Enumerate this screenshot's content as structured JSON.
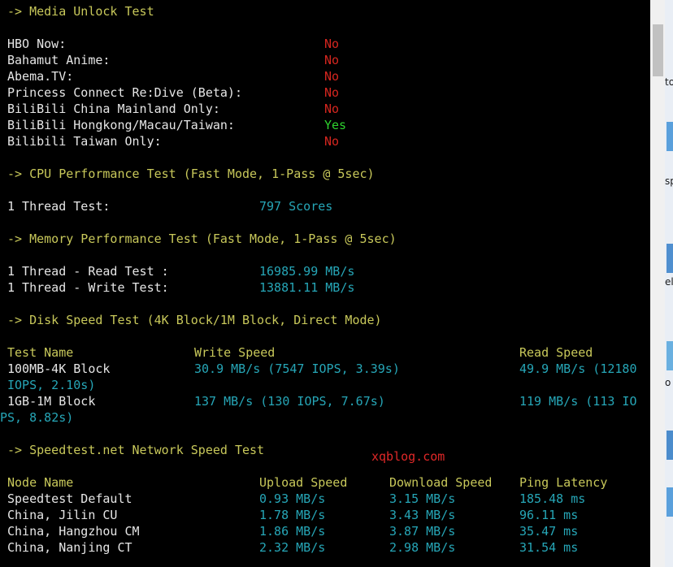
{
  "media_header": "-> Media Unlock Test",
  "media": [
    {
      "name": "HBO Now:",
      "result": "No",
      "ok": false
    },
    {
      "name": "Bahamut Anime:",
      "result": "No",
      "ok": false
    },
    {
      "name": "Abema.TV:",
      "result": "No",
      "ok": false
    },
    {
      "name": "Princess Connect Re:Dive (Beta):",
      "result": "No",
      "ok": false
    },
    {
      "name": "BiliBili China Mainland Only:",
      "result": "No",
      "ok": false
    },
    {
      "name": "BiliBili Hongkong/Macau/Taiwan:",
      "result": "Yes",
      "ok": true
    },
    {
      "name": "Bilibili Taiwan Only:",
      "result": "No",
      "ok": false
    }
  ],
  "cpu_header": "-> CPU Performance Test (Fast Mode, 1-Pass @ 5sec)",
  "cpu": {
    "label": "1 Thread Test:",
    "value": "797 Scores"
  },
  "memory_header": "-> Memory Performance Test (Fast Mode, 1-Pass @ 5sec)",
  "memory": [
    {
      "label": "1 Thread - Read Test :",
      "value": "16985.99 MB/s"
    },
    {
      "label": "1 Thread - Write Test:",
      "value": "13881.11 MB/s"
    }
  ],
  "disk_header": "-> Disk Speed Test (4K Block/1M Block, Direct Mode)",
  "disk_columns": [
    "Test Name",
    "Write Speed",
    "Read Speed"
  ],
  "disk_rows": [
    {
      "name": "100MB-4K Block",
      "write": "30.9 MB/s (7547 IOPS, 3.39s)",
      "read": "49.9 MB/s (12180",
      "wrap": "IOPS, 2.10s)"
    },
    {
      "name": "1GB-1M Block",
      "write": "137 MB/s (130 IOPS, 7.67s)",
      "read": "119 MB/s (113 IO",
      "wrap": "PS, 8.82s)"
    }
  ],
  "speedtest_header": "-> Speedtest.net Network Speed Test",
  "watermark": "xqblog.com",
  "speed_columns": [
    "Node Name",
    "Upload Speed",
    "Download Speed",
    "Ping Latency"
  ],
  "speed_rows": [
    {
      "node": "Speedtest Default",
      "upload": "0.93 MB/s",
      "download": "3.15 MB/s",
      "ping": "185.48 ms"
    },
    {
      "node": "China, Jilin CU",
      "upload": "1.78 MB/s",
      "download": "3.43 MB/s",
      "ping": "96.11 ms"
    },
    {
      "node": "China, Hangzhou CM",
      "upload": "1.86 MB/s",
      "download": "3.87 MB/s",
      "ping": "35.47 ms"
    },
    {
      "node": "China, Nanjing CT",
      "upload": "2.32 MB/s",
      "download": "2.98 MB/s",
      "ping": "31.54 ms"
    }
  ],
  "desktop_fragments": [
    "to",
    "sp",
    "el",
    "o"
  ],
  "colors": {
    "header": "#c8c85a",
    "text": "#e6e6e6",
    "fail": "#d4261f",
    "pass": "#2ed22e",
    "value": "#26a6b7",
    "watermark": "#e02828"
  }
}
